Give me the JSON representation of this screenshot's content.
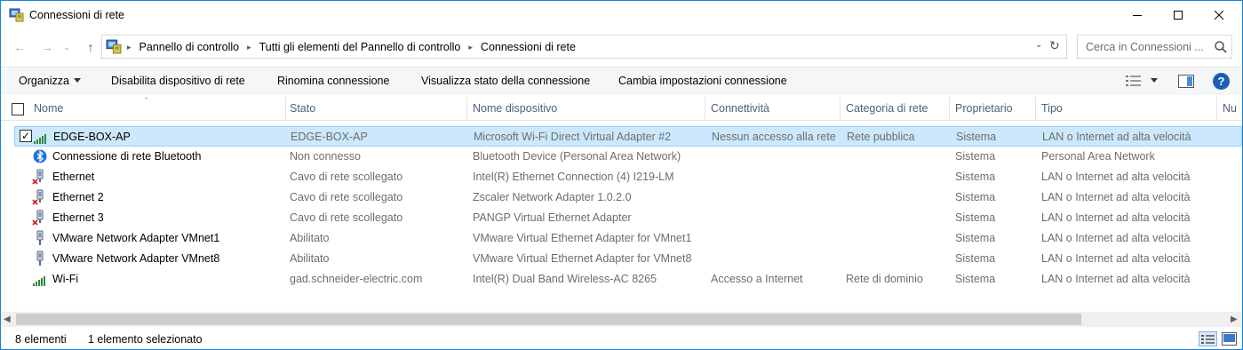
{
  "window": {
    "title": "Connessioni di rete",
    "icons": [
      "control-panel-network-icon",
      "minimize-icon",
      "maximize-icon",
      "close-icon"
    ]
  },
  "address": {
    "crumbs": [
      "Pannello di controllo",
      "Tutti gli elementi del Pannello di controllo",
      "Connessioni di rete"
    ],
    "search_placeholder": "Cerca in Connessioni ..."
  },
  "toolbar": {
    "organize": "Organizza",
    "disable": "Disabilita dispositivo di rete",
    "rename": "Rinomina connessione",
    "view_status": "Visualizza stato della connessione",
    "change_settings": "Cambia impostazioni connessione",
    "help": "?"
  },
  "columns": {
    "name": "Nome",
    "status": "Stato",
    "device": "Nome dispositivo",
    "connectivity": "Connettività",
    "category": "Categoria di rete",
    "owner": "Proprietario",
    "type": "Tipo",
    "extra": "Nu"
  },
  "rows": [
    {
      "name": "EDGE-BOX-AP",
      "status": "EDGE-BOX-AP",
      "device": "Microsoft Wi-Fi Direct Virtual Adapter #2",
      "connectivity": "Nessun accesso alla rete",
      "category": "Rete pubblica",
      "owner": "Sistema",
      "type": "LAN o Internet ad alta velocità",
      "icon": "wifi-signal-icon",
      "selected": true
    },
    {
      "name": "Connessione di rete Bluetooth",
      "status": "Non connesso",
      "device": "Bluetooth Device (Personal Area Network)",
      "connectivity": "",
      "category": "",
      "owner": "Sistema",
      "type": "Personal Area Network",
      "icon": "bluetooth-icon"
    },
    {
      "name": "Ethernet",
      "status": "Cavo di rete scollegato",
      "device": "Intel(R) Ethernet Connection (4) I219-LM",
      "connectivity": "",
      "category": "",
      "owner": "Sistema",
      "type": "LAN o Internet ad alta velocità",
      "icon": "ethernet-disconnected-icon"
    },
    {
      "name": "Ethernet 2",
      "status": "Cavo di rete scollegato",
      "device": "Zscaler Network Adapter 1.0.2.0",
      "connectivity": "",
      "category": "",
      "owner": "Sistema",
      "type": "LAN o Internet ad alta velocità",
      "icon": "ethernet-disconnected-icon"
    },
    {
      "name": "Ethernet 3",
      "status": "Cavo di rete scollegato",
      "device": "PANGP Virtual Ethernet Adapter",
      "connectivity": "",
      "category": "",
      "owner": "Sistema",
      "type": "LAN o Internet ad alta velocità",
      "icon": "ethernet-disconnected-icon"
    },
    {
      "name": "VMware Network Adapter VMnet1",
      "status": "Abilitato",
      "device": "VMware Virtual Ethernet Adapter for VMnet1",
      "connectivity": "",
      "category": "",
      "owner": "Sistema",
      "type": "LAN o Internet ad alta velocità",
      "icon": "ethernet-icon"
    },
    {
      "name": "VMware Network Adapter VMnet8",
      "status": "Abilitato",
      "device": "VMware Virtual Ethernet Adapter for VMnet8",
      "connectivity": "",
      "category": "",
      "owner": "Sistema",
      "type": "LAN o Internet ad alta velocità",
      "icon": "ethernet-icon"
    },
    {
      "name": "Wi-Fi",
      "status": "gad.schneider-electric.com",
      "device": "Intel(R) Dual Band Wireless-AC 8265",
      "connectivity": "Accesso a Internet",
      "category": "Rete di dominio",
      "owner": "Sistema",
      "type": "LAN o Internet ad alta velocità",
      "icon": "wifi-signal-icon"
    }
  ],
  "status": {
    "count": "8 elementi",
    "selected": "1 elemento selezionato"
  },
  "colors": {
    "selection_bg": "#cce8ff",
    "selection_border": "#99d1ff",
    "header_text": "#4c607a",
    "window_border": "#1883d7"
  }
}
